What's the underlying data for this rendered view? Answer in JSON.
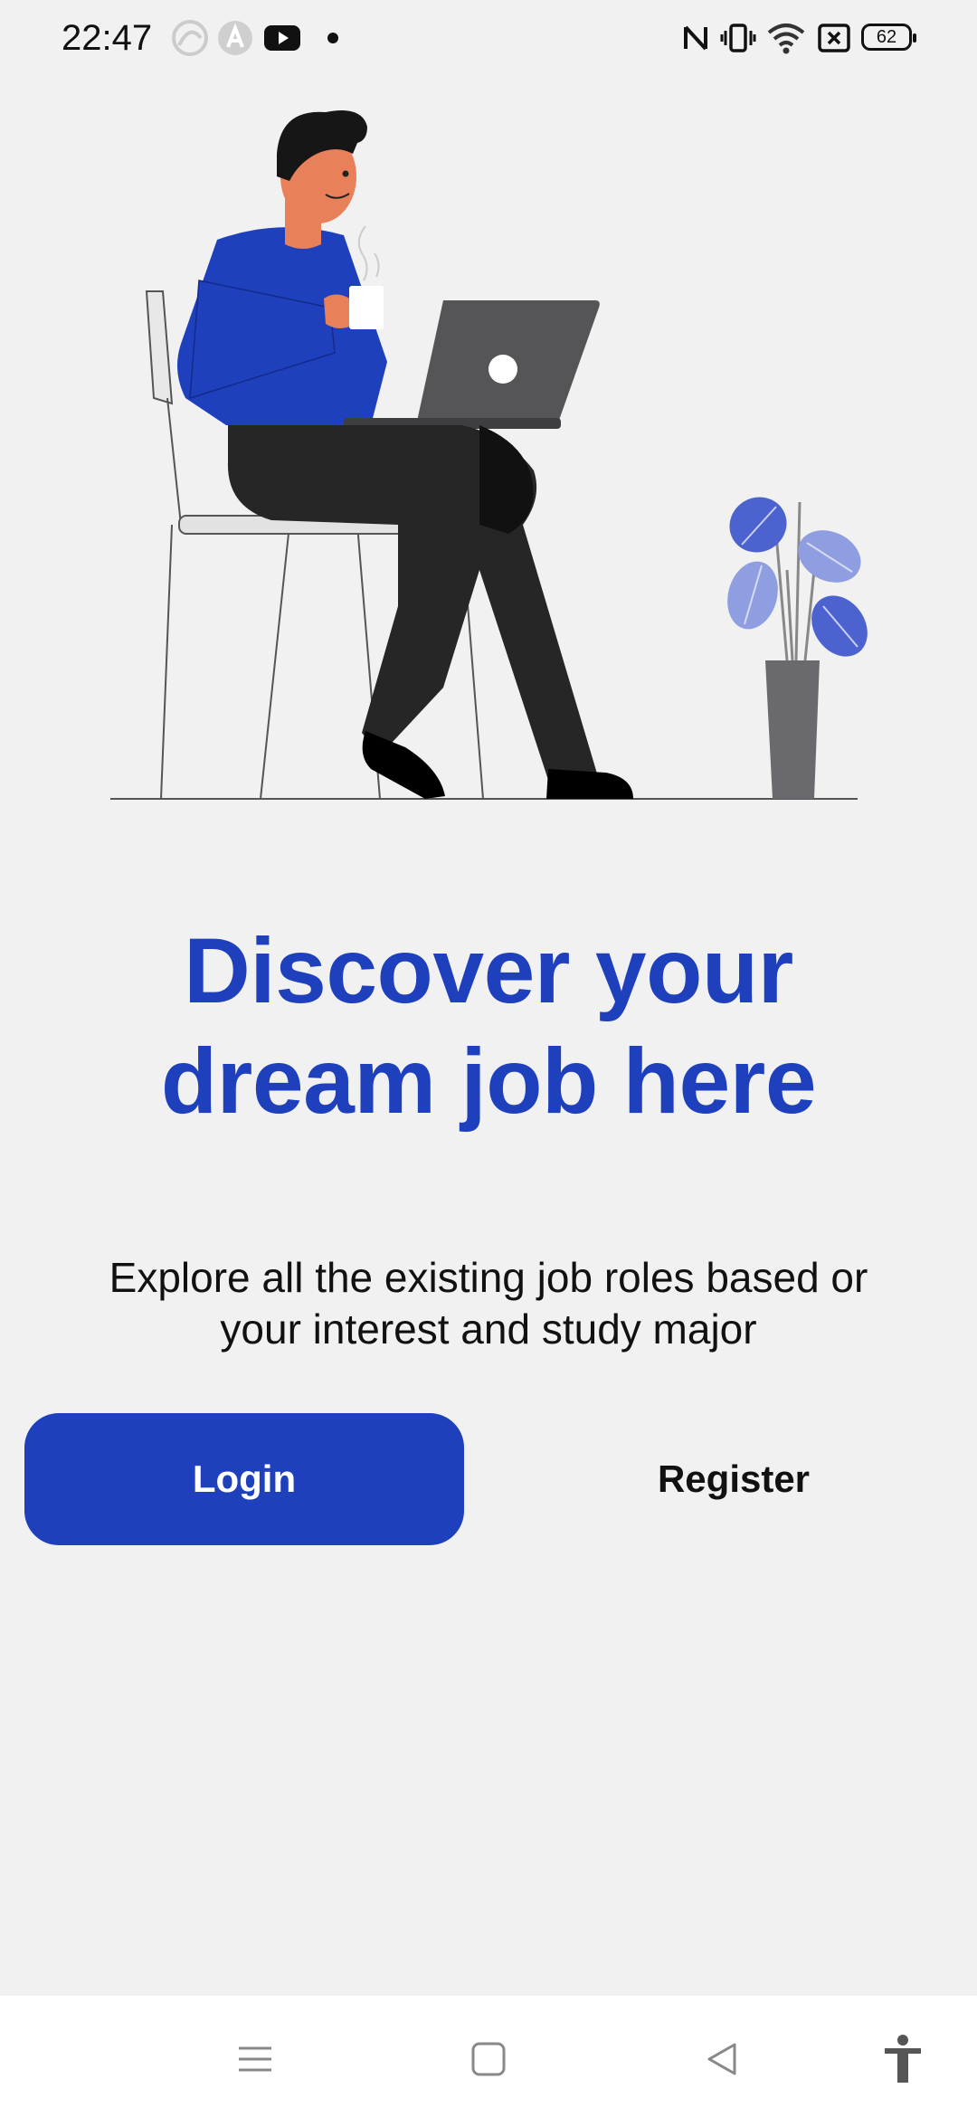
{
  "status_bar": {
    "time": "22:47",
    "battery_level": "62",
    "left_icons": [
      "hotspot-icon",
      "app-a-icon",
      "youtube-icon",
      "notification-dot-icon"
    ],
    "right_icons": [
      "nfc-icon",
      "vibrate-icon",
      "wifi-icon",
      "sim-error-icon",
      "battery-icon"
    ]
  },
  "hero": {
    "title_line1": "Discover your",
    "title_line2": "dream job here",
    "subtitle_line1": "Explore all the existing job roles based or",
    "subtitle_line2": "your interest and study major"
  },
  "actions": {
    "login_label": "Login",
    "register_label": "Register"
  },
  "nav": {
    "items": [
      "menu-icon",
      "home-icon",
      "back-icon",
      "accessibility-icon"
    ]
  },
  "colors": {
    "accent": "#1f40bd",
    "background": "#f2f1f1",
    "text": "#111111",
    "nav_background": "#ffffff"
  }
}
